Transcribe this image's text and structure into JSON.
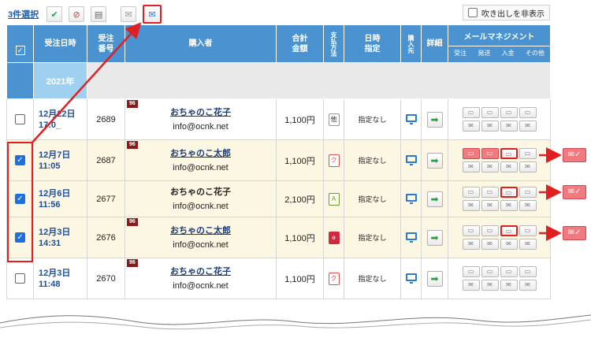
{
  "toolbar": {
    "selected_count": "3件選択",
    "hide_bubble_label": "吹き出しを非表示"
  },
  "columns": {
    "order_datetime": "受注日時",
    "order_number": "受注\n番号",
    "buyer": "購入者",
    "total": "合計\n金額",
    "payment": "支払方法",
    "date_spec": "日時\n指定",
    "purchase_from": "購入先",
    "detail": "詳細",
    "mail_mgmt": "メールマネジメント",
    "mail_sub": [
      "受注",
      "発送",
      "入金",
      "その他"
    ]
  },
  "year_label": "2021年",
  "rows": [
    {
      "date": "12月22日",
      "time": "17:0_",
      "order_no": "2689",
      "buyer_name": "おちゃのこ花子",
      "buyer_email": "info@ocnk.net",
      "total": "1,100円",
      "payment_glyph": "他",
      "date_spec": "指定なし",
      "checked": false,
      "tag": "96"
    },
    {
      "date": "12月7日",
      "time": "11:05",
      "order_no": "2687",
      "buyer_name": "おちゃのこ太郎",
      "buyer_email": "info@ocnk.net",
      "total": "1,100円",
      "payment_glyph": "ク",
      "date_spec": "指定なし",
      "checked": true,
      "tag": "96"
    },
    {
      "date": "12月6日",
      "time": "11:56",
      "order_no": "2677",
      "buyer_name": "おちゃのこ花子",
      "buyer_email": "info@ocnk.net",
      "total": "2,100円",
      "payment_glyph": "A",
      "date_spec": "指定なし",
      "checked": true,
      "tag": ""
    },
    {
      "date": "12月3日",
      "time": "14:31",
      "order_no": "2676",
      "buyer_name": "おちゃのこ太郎",
      "buyer_email": "info@ocnk.net",
      "total": "1,100円",
      "payment_glyph": "ə",
      "date_spec": "指定なし",
      "checked": true,
      "tag": "96"
    },
    {
      "date": "12月3日",
      "time": "11:48",
      "order_no": "2670",
      "buyer_name": "おちゃのこ花子",
      "buyer_email": "info@ocnk.net",
      "total": "1,100円",
      "payment_glyph": "ク",
      "date_spec": "指定なし",
      "checked": false,
      "tag": "96"
    }
  ],
  "colors": {
    "header": "#4a93d0",
    "year": "#9fd0ef",
    "highlight": "#e02020",
    "selected_row": "#fbf7e3"
  }
}
